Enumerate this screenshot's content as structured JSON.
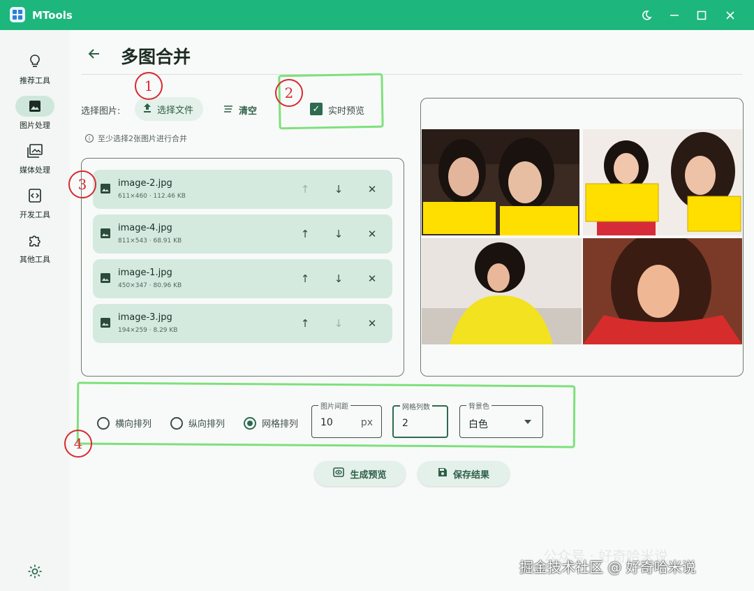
{
  "app": {
    "title": "MTools"
  },
  "window_controls": {
    "theme": "moon-icon",
    "minimize": "–",
    "maximize": "□",
    "close": "✕"
  },
  "sidebar": {
    "items": [
      {
        "label": "推荐工具",
        "icon": "bulb-icon",
        "active": false
      },
      {
        "label": "图片处理",
        "icon": "image-icon",
        "active": true
      },
      {
        "label": "媒体处理",
        "icon": "media-icon",
        "active": false
      },
      {
        "label": "开发工具",
        "icon": "code-icon",
        "active": false
      },
      {
        "label": "其他工具",
        "icon": "puzzle-icon",
        "active": false
      }
    ],
    "settings_icon": "gear-icon"
  },
  "page": {
    "title": "多图合并"
  },
  "toolbar": {
    "select_label": "选择图片:",
    "choose_file": "选择文件",
    "clear": "清空",
    "live_preview": "实时预览",
    "live_preview_checked": true
  },
  "hint": "至少选择2张图片进行合并",
  "files": [
    {
      "name": "image-2.jpg",
      "meta": "611×460 · 112.46 KB",
      "up_enabled": false,
      "down_enabled": true
    },
    {
      "name": "image-4.jpg",
      "meta": "811×543 · 68.91 KB",
      "up_enabled": true,
      "down_enabled": true
    },
    {
      "name": "image-1.jpg",
      "meta": "450×347 · 80.96 KB",
      "up_enabled": true,
      "down_enabled": true
    },
    {
      "name": "image-3.jpg",
      "meta": "194×259 · 8.29 KB",
      "up_enabled": true,
      "down_enabled": false
    }
  ],
  "layout_options": {
    "horizontal": "横向排列",
    "vertical": "纵向排列",
    "grid": "网格排列",
    "selected": "grid"
  },
  "fields": {
    "spacing": {
      "label": "图片间距",
      "value": "10",
      "suffix": "px"
    },
    "columns": {
      "label": "网格列数",
      "value": "2"
    },
    "background": {
      "label": "背景色",
      "value": "白色"
    }
  },
  "actions": {
    "generate": "生成预览",
    "save": "保存结果"
  },
  "annotations": [
    "1",
    "2",
    "3",
    "4"
  ],
  "watermark": {
    "back": "公众号 · 好奇哈米说",
    "front": "掘金技术社区 @ 好奇哈米说"
  },
  "colors": {
    "titlebar": "#1db67d",
    "accent": "#2d6a4f",
    "file_row": "#d4eadf",
    "annotation": "#d9282f",
    "highlight": "#7ee07c"
  }
}
